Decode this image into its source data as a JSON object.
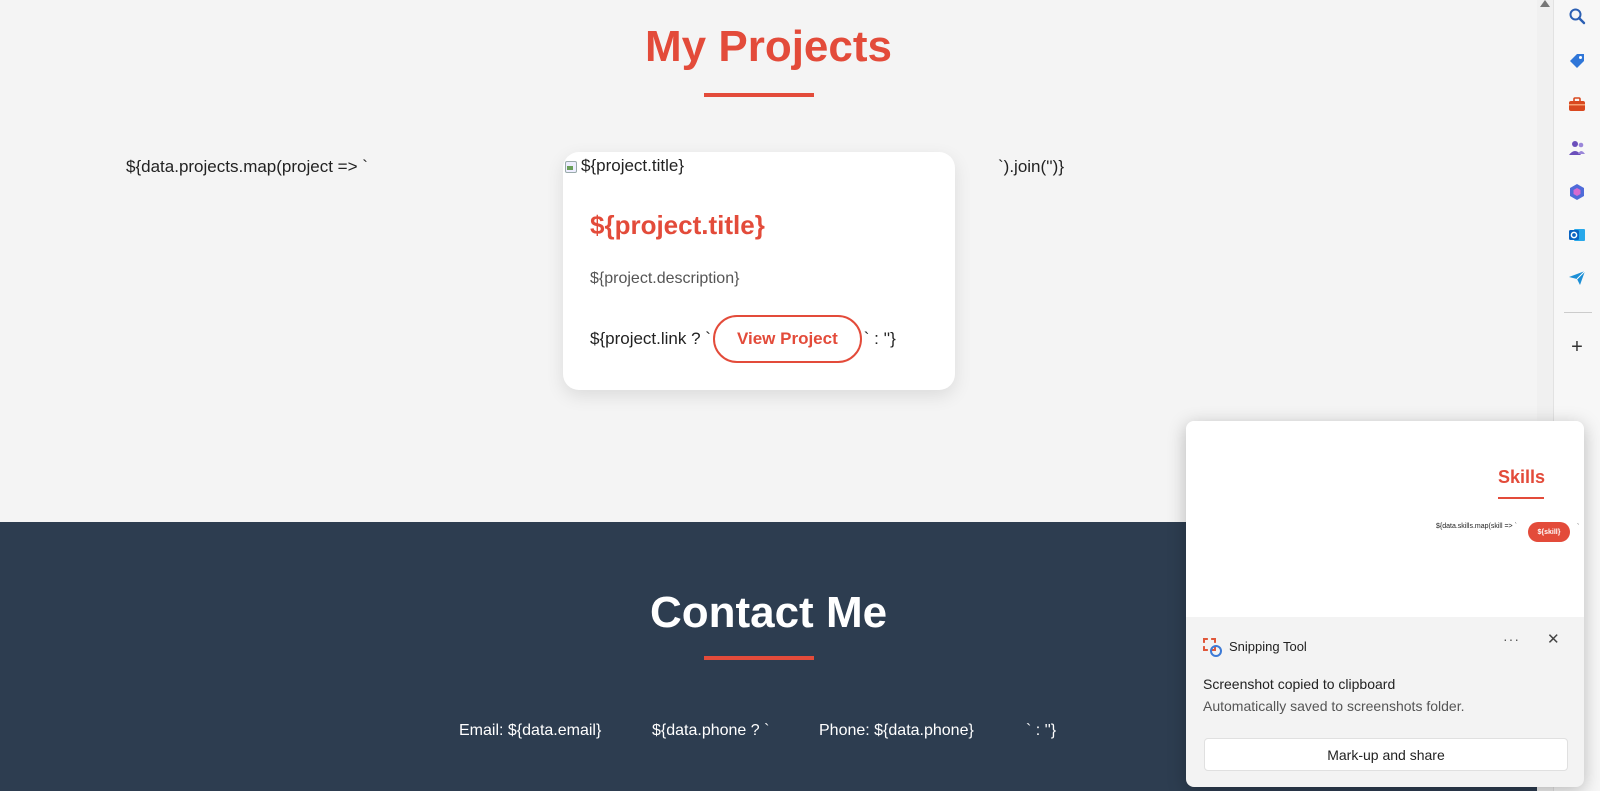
{
  "projects": {
    "title": "My Projects",
    "template_open": "${data.projects.map(project => `",
    "template_close": "`).join('')}",
    "card": {
      "image_alt": "${project.title}",
      "title": "${project.title}",
      "description": "${project.description}",
      "link_prefix": "${project.link ? `",
      "button_label": "View Project",
      "link_suffix": "` : ''}"
    }
  },
  "contact": {
    "title": "Contact Me",
    "email": "Email: ${data.email}",
    "phone_open": "${data.phone ? `",
    "phone": "Phone: ${data.phone}",
    "phone_close": "` : ''}"
  },
  "sidebar": {
    "icons": [
      "search-icon",
      "tag-icon",
      "toolbox-icon",
      "people-icon",
      "copilot-icon",
      "outlook-icon",
      "send-icon"
    ],
    "add_glyph": "+"
  },
  "toast": {
    "app_name": "Snipping Tool",
    "more_glyph": "···",
    "close_glyph": "✕",
    "message": "Screenshot copied to clipboard",
    "sub_message": "Automatically saved to screenshots folder.",
    "button_label": "Mark-up and share",
    "preview": {
      "title": "Skills",
      "template": "${data.skills.map(skill => `",
      "badge": "${skill}",
      "tail": "`"
    }
  },
  "colors": {
    "accent": "#e34b3a",
    "contact_bg": "#2d3d50",
    "page_bg": "#f4f4f4"
  }
}
